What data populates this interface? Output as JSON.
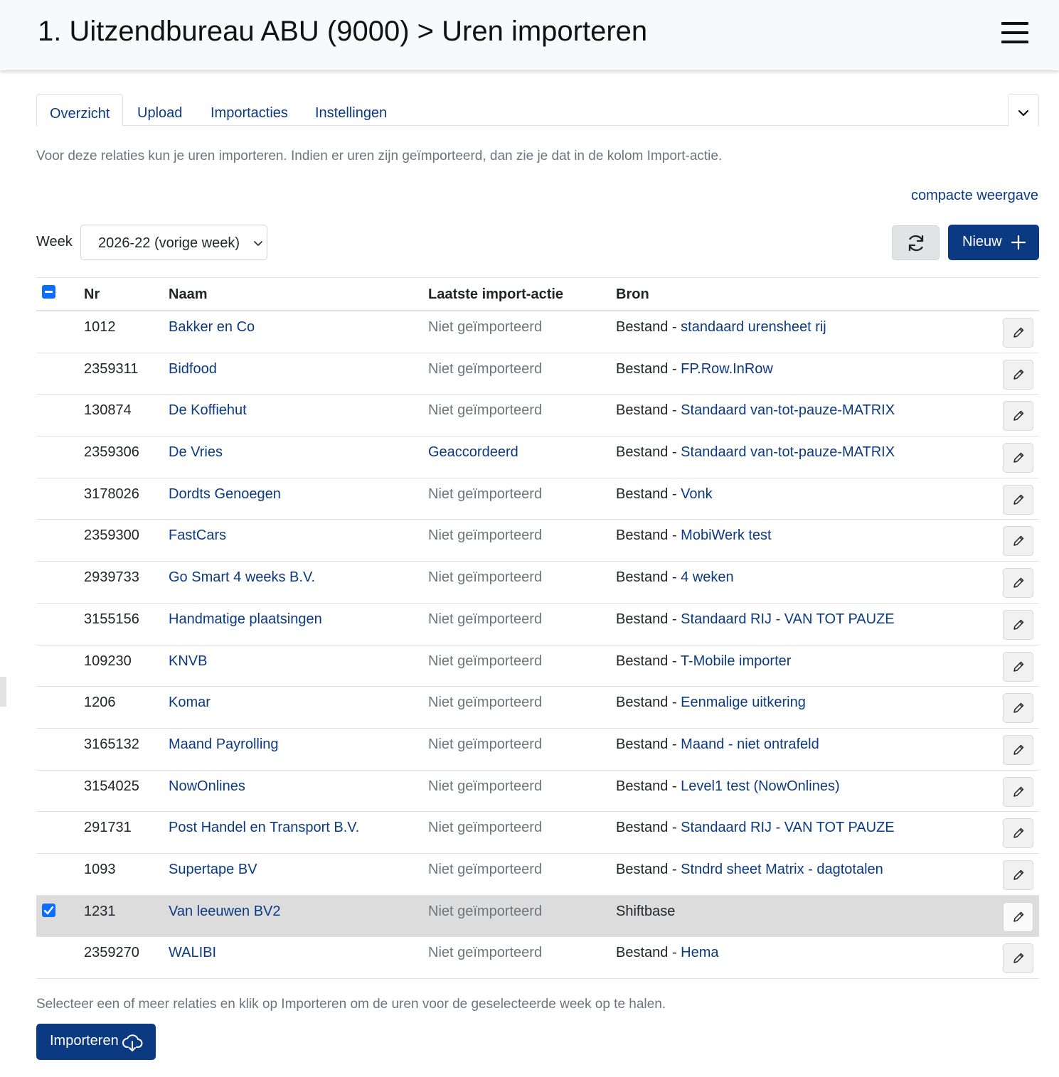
{
  "header": {
    "title": "1. Uitzendbureau ABU (9000) > Uren importeren",
    "menu_icon": "hamburger-icon"
  },
  "tabs": [
    {
      "label": "Overzicht",
      "active": true
    },
    {
      "label": "Upload",
      "active": false
    },
    {
      "label": "Importacties",
      "active": false
    },
    {
      "label": "Instellingen",
      "active": false
    }
  ],
  "tabs_toggle_icon": "chevron-down-icon",
  "intro_text": "Voor deze relaties kun je uren importeren. Indien er uren zijn geïmporteerd, dan zie je dat in de kolom Import-actie.",
  "compact_view_link": "compacte weergave",
  "week": {
    "label": "Week",
    "selected": "2026-22 (vorige week)"
  },
  "toolbar": {
    "refresh_icon": "refresh-icon",
    "new_label": "Nieuw",
    "new_icon": "plus-icon"
  },
  "table": {
    "columns": [
      "Nr",
      "Naam",
      "Laatste import-actie",
      "Bron"
    ],
    "rows": [
      {
        "nr": "1012",
        "name": "Bakker en Co",
        "status": "Niet geïmporteerd",
        "bron_prefix": "Bestand - ",
        "bron_link": "standaard urensheet rij",
        "checked": false
      },
      {
        "nr": "2359311",
        "name": "Bidfood",
        "status": "Niet geïmporteerd",
        "bron_prefix": "Bestand - ",
        "bron_link": "FP.Row.InRow",
        "checked": false
      },
      {
        "nr": "130874",
        "name": "De Koffiehut",
        "status": "Niet geïmporteerd",
        "bron_prefix": "Bestand - ",
        "bron_link": "Standaard van-tot-pauze-MATRIX",
        "checked": false
      },
      {
        "nr": "2359306",
        "name": "De Vries",
        "status": "Geaccordeerd",
        "bron_prefix": "Bestand - ",
        "bron_link": "Standaard van-tot-pauze-MATRIX",
        "checked": false
      },
      {
        "nr": "3178026",
        "name": "Dordts Genoegen",
        "status": "Niet geïmporteerd",
        "bron_prefix": "Bestand - ",
        "bron_link": "Vonk",
        "checked": false
      },
      {
        "nr": "2359300",
        "name": "FastCars",
        "status": "Niet geïmporteerd",
        "bron_prefix": "Bestand - ",
        "bron_link": "MobiWerk test",
        "checked": false
      },
      {
        "nr": "2939733",
        "name": "Go Smart 4 weeks B.V.",
        "status": "Niet geïmporteerd",
        "bron_prefix": "Bestand - ",
        "bron_link": "4 weken",
        "checked": false
      },
      {
        "nr": "3155156",
        "name": "Handmatige plaatsingen",
        "status": "Niet geïmporteerd",
        "bron_prefix": "Bestand - ",
        "bron_link": "Standaard RIJ - VAN TOT PAUZE",
        "checked": false
      },
      {
        "nr": "109230",
        "name": "KNVB",
        "status": "Niet geïmporteerd",
        "bron_prefix": "Bestand - ",
        "bron_link": "T-Mobile importer",
        "checked": false
      },
      {
        "nr": "1206",
        "name": "Komar",
        "status": "Niet geïmporteerd",
        "bron_prefix": "Bestand - ",
        "bron_link": "Eenmalige uitkering",
        "checked": false
      },
      {
        "nr": "3165132",
        "name": "Maand Payrolling",
        "status": "Niet geïmporteerd",
        "bron_prefix": "Bestand - ",
        "bron_link": "Maand - niet ontrafeld",
        "checked": false
      },
      {
        "nr": "3154025",
        "name": "NowOnlines",
        "status": "Niet geïmporteerd",
        "bron_prefix": "Bestand - ",
        "bron_link": "Level1 test (NowOnlines)",
        "checked": false
      },
      {
        "nr": "291731",
        "name": "Post Handel en Transport B.V.",
        "status": "Niet geïmporteerd",
        "bron_prefix": "Bestand - ",
        "bron_link": "Standaard RIJ - VAN TOT PAUZE",
        "checked": false
      },
      {
        "nr": "1093",
        "name": "Supertape BV",
        "status": "Niet geïmporteerd",
        "bron_prefix": "Bestand - ",
        "bron_link": "Stndrd sheet Matrix - dagtotalen",
        "checked": false
      },
      {
        "nr": "1231",
        "name": "Van leeuwen BV2",
        "status": "Niet geïmporteerd",
        "bron_prefix": "Shiftbase",
        "bron_link": "",
        "checked": true
      },
      {
        "nr": "2359270",
        "name": "WALIBI",
        "status": "Niet geïmporteerd",
        "bron_prefix": "Bestand - ",
        "bron_link": "Hema",
        "checked": false
      }
    ],
    "row_edit_icon": "pencil-icon"
  },
  "footer": {
    "instruction": "Selecteer een of meer relaties en klik op Importeren om de uren voor de geselecteerde week op te halen.",
    "import_label": "Importeren",
    "import_icon": "cloud-download-icon"
  },
  "colors": {
    "primary": "#0b3a82",
    "checkbox": "#0d6efd",
    "muted": "#6c757d",
    "selected_row": "#dcdcdc"
  }
}
